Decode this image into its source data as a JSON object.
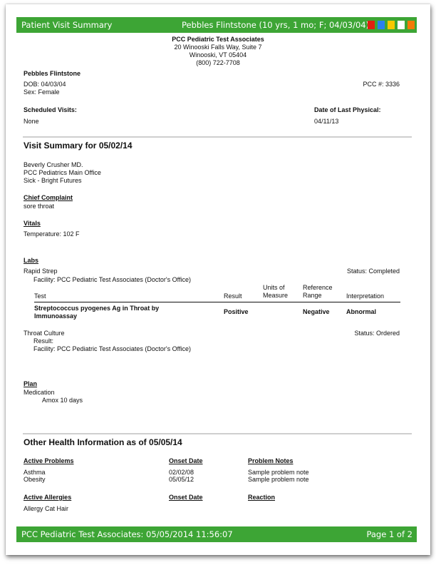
{
  "header": {
    "title": "Patient Visit Summary",
    "patient_banner": "Pebbles Flintstone (10 yrs, 1 mo; F; 04/03/04)",
    "flags": [
      {
        "name": "red-flag",
        "color": "#e02010"
      },
      {
        "name": "blue-flag",
        "color": "#2a80f0"
      },
      {
        "name": "yellow-flag",
        "color": "#f8c800"
      },
      {
        "name": "white-flag",
        "color": "#ffffff"
      },
      {
        "name": "orange-flag",
        "color": "#f47a08"
      }
    ],
    "bar_color": "#3da535"
  },
  "practice": {
    "name": "PCC Pediatric Test Associates",
    "address1": "20 Winooski Falls Way, Suite 7",
    "address2": "Winooski, VT 05404",
    "phone": "(800) 722-7708"
  },
  "patient": {
    "name": "Pebbles Flintstone",
    "dob": "DOB: 04/03/04",
    "sex": "Sex: Female",
    "pcc_number": "PCC #: 3336",
    "scheduled_visits_label": "Scheduled Visits:",
    "scheduled_visits_value": "None",
    "last_physical_label": "Date of Last Physical:",
    "last_physical_value": "04/11/13"
  },
  "visit": {
    "heading": "Visit Summary for 05/02/14",
    "provider": "Beverly Crusher MD.",
    "location": "PCC Pediatrics Main Office",
    "visit_type": "Sick - Bright Futures",
    "chief_complaint_label": "Chief Complaint",
    "chief_complaint": "sore throat",
    "vitals_label": "Vitals",
    "temperature": "Temperature: 102 F",
    "labs_label": "Labs",
    "labs": [
      {
        "name": "Rapid Strep",
        "status": "Status: Completed",
        "facility": "Facility: PCC Pediatric Test Associates (Doctor's Office)",
        "table": {
          "headers": {
            "test": "Test",
            "result": "Result",
            "units_line1": "Units of",
            "units_line2": "Measure",
            "range_line1": "Reference",
            "range_line2": "Range",
            "interpretation": "Interpretation"
          },
          "rows": [
            {
              "test_line1": "Streptococcus pyogenes Ag in Throat by",
              "test_line2": "Immunoassay",
              "result": "Positive",
              "units": "",
              "range": "Negative",
              "interpretation": "Abnormal"
            }
          ]
        }
      },
      {
        "name": "Throat Culture",
        "status": "Status: Ordered",
        "result": "Result:",
        "facility": "Facility: PCC Pediatric Test Associates (Doctor's Office)"
      }
    ],
    "plan_label": "Plan",
    "plan_category": "Medication",
    "plan_item": "Amox 10 days"
  },
  "other_health": {
    "heading": "Other Health Information as of 05/05/14",
    "problems_header": "Active Problems",
    "onset_header": "Onset Date",
    "notes_header": "Problem Notes",
    "problems": [
      {
        "name": "Asthma",
        "onset": "02/02/08",
        "note": "Sample problem note"
      },
      {
        "name": "Obesity",
        "onset": "05/05/12",
        "note": "Sample problem note"
      }
    ],
    "allergies_header": "Active Allergies",
    "allergy_onset_header": "Onset Date",
    "reaction_header": "Reaction",
    "allergies": [
      {
        "name": "Allergy Cat Hair"
      }
    ]
  },
  "footer": {
    "left": "PCC Pediatric Test Associates: 05/05/2014 11:56:07",
    "right": "Page 1 of 2"
  }
}
